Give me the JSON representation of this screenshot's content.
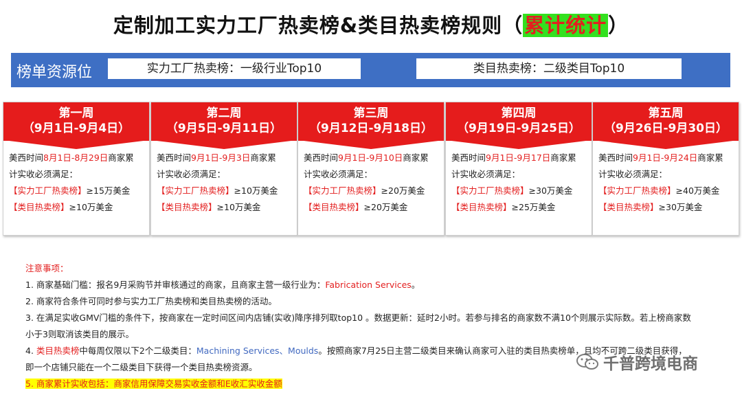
{
  "title": {
    "main": "定制加工实力工厂热卖榜&类目热卖榜规则（",
    "highlight": "累计统计",
    "end": "）"
  },
  "band": {
    "label": "榜单资源位",
    "box1": "实力工厂热卖榜：一级行业Top10",
    "box2": "类目热卖榜：二级类目Top10"
  },
  "weeks": [
    {
      "name": "第一周",
      "range": "（9月1日-9月4日）",
      "pre": "美西时间",
      "period": "8月1日-8月29日",
      "post": "商家累",
      "line2": "计实收必须满足：",
      "l3tag": "【实力工厂热卖榜】",
      "l3val": "≥15万美金",
      "l4tag": "【类目热卖榜】",
      "l4val": "≥10万美金"
    },
    {
      "name": "第二周",
      "range": "（9月5日-9月11日）",
      "pre": "美西时间",
      "period": "9月1日-9月3日",
      "post": "商家累",
      "line2": "计实收必须满足：",
      "l3tag": "【实力工厂热卖榜】",
      "l3val": "≥10万美金",
      "l4tag": "【类目热卖榜】",
      "l4val": "≥10万美金"
    },
    {
      "name": "第三周",
      "range": "（9月12日-9月18日）",
      "pre": "美西时间",
      "period": "9月1日-9月10日",
      "post": "商家累",
      "line2": "计实收必须满足：",
      "l3tag": "【实力工厂热卖榜】",
      "l3val": "≥20万美金",
      "l4tag": "【类目热卖榜】",
      "l4val": "≥20万美金"
    },
    {
      "name": "第四周",
      "range": "（9月19日-9月25日）",
      "pre": "美西时间",
      "period": "9月1日-9月17日",
      "post": "商家累",
      "line2": "计实收必须满足：",
      "l3tag": "【实力工厂热卖榜】",
      "l3val": "≥30万美金",
      "l4tag": "【类目热卖榜】",
      "l4val": "≥25万美金"
    },
    {
      "name": "第五周",
      "range": "（9月26日-9月30日）",
      "pre": "美西时间",
      "period": "9月1日-9月24日",
      "post": "商家累",
      "line2": "计实收必须满足：",
      "l3tag": "【实力工厂热卖榜】",
      "l3val": "≥40万美金",
      "l4tag": "【类目热卖榜】",
      "l4val": "≥30万美金"
    }
  ],
  "notes": {
    "heading": "注意事项：",
    "n1a": "1. 商家基础门槛：报名9月采购节并审核通过的商家，且商家主营一级行业为：",
    "n1b": "Fabrication Services",
    "n1c": "。",
    "n2": "2. 商家符合条件可同时参与实力工厂热卖榜和类目热卖榜的活动。",
    "n3a": "3. 在满足实收GMV门槛的条件下，按商家在一定时间区间内店铺(实收)降序排列取top10 。数据更新：延时2小时。若参与排名的商家数不满10个则展示实际数。若上榜商家数",
    "n3b": "小于3则取消该类目的展示。",
    "n4a": "4. ",
    "n4b": "类目热卖榜",
    "n4c": "中每周仅限以下2个二级类目：",
    "n4d": "Machining Services、Moulds",
    "n4e": "。按照商家7月25日主营二级类目来确认商家可入驻的类目热卖榜单，且均不可跨二级类目获得，",
    "n4f": "即一个店铺只能在一个二级类目下获得一个类目热卖榜资源。",
    "n5": "5. 商家累计实收包括：商家信用保障交易实收金额和E收汇实收金额"
  },
  "watermark": "千普跨境电商",
  "colors": {
    "red": "#e51c1c",
    "blue": "#3e6fc4",
    "highlight_green": "#33e01f",
    "highlight_yellow": "#ffff00",
    "link_blue": "#4169c0"
  }
}
